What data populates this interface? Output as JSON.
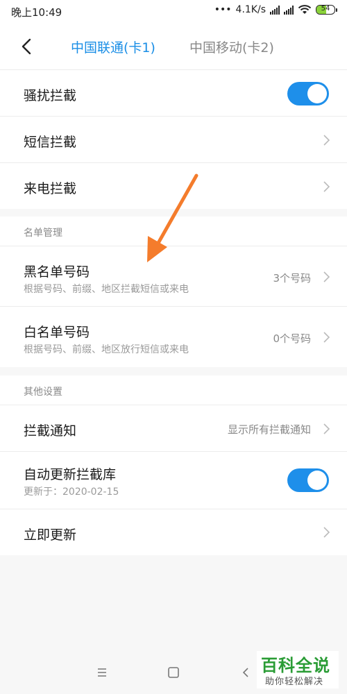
{
  "status_bar": {
    "time": "晚上10:49",
    "net_speed": "4.1K/s",
    "battery_level": "54",
    "battery_fraction": 0.54
  },
  "header": {
    "tabs": [
      {
        "label": "中国联通(卡1)",
        "active": true
      },
      {
        "label": "中国移动(卡2)",
        "active": false
      }
    ],
    "accent_color": "#1a8ee6"
  },
  "settings": {
    "harass_block": {
      "label": "骚扰拦截",
      "enabled": true
    },
    "sms_block": {
      "label": "短信拦截"
    },
    "call_block": {
      "label": "来电拦截"
    }
  },
  "list_management": {
    "section_label": "名单管理",
    "blacklist": {
      "label": "黑名单号码",
      "subtitle": "根据号码、前缀、地区拦截短信或来电",
      "count": "3个号码"
    },
    "whitelist": {
      "label": "白名单号码",
      "subtitle": "根据号码、前缀、地区放行短信或来电",
      "count": "0个号码"
    }
  },
  "other_settings": {
    "section_label": "其他设置",
    "block_notify": {
      "label": "拦截通知",
      "value": "显示所有拦截通知"
    },
    "auto_update": {
      "label": "自动更新拦截库",
      "subtitle": "更新于：2020-02-15",
      "enabled": true
    },
    "update_now": {
      "label": "立即更新"
    }
  },
  "annotation": {
    "arrow_color": "#f47c2c"
  },
  "nav_bar": {
    "icons": [
      "menu-icon",
      "home-icon",
      "back-icon"
    ]
  },
  "watermark": {
    "title": "百科全说",
    "subtitle": "助你轻松解决",
    "color": "#2a9c35"
  }
}
